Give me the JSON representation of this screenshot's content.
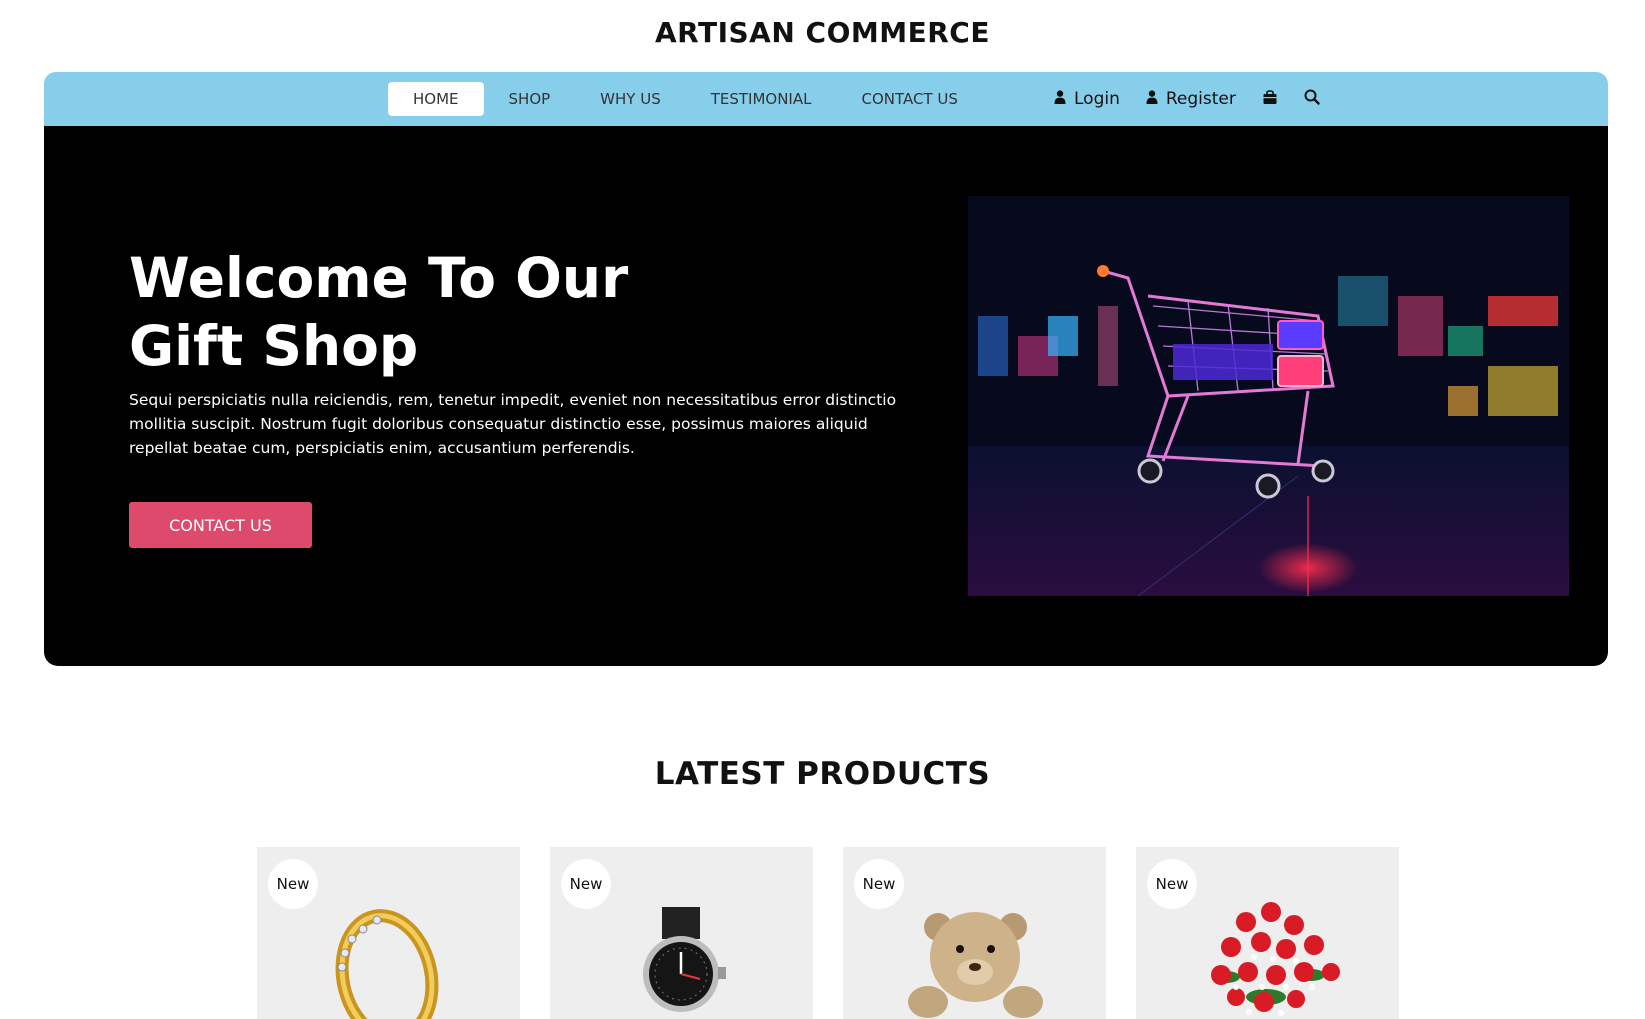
{
  "site": {
    "title": "ARTISAN COMMERCE"
  },
  "nav": {
    "links": [
      {
        "label": "HOME",
        "active": true
      },
      {
        "label": "SHOP",
        "active": false
      },
      {
        "label": "WHY US",
        "active": false
      },
      {
        "label": "TESTIMONIAL",
        "active": false
      },
      {
        "label": "CONTACT US",
        "active": false
      }
    ],
    "login_label": "Login",
    "register_label": "Register",
    "cart_icon": "shopping-bag-icon",
    "search_icon": "search-icon",
    "bar_color": "#87ceeb"
  },
  "hero": {
    "title_line1": "Welcome To Our",
    "title_line2": "Gift Shop",
    "text": "Sequi perspiciatis nulla reiciendis, rem, tenetur impedit, eveniet non necessitatibus error distinctio mollitia suscipit. Nostrum fugit doloribus consequatur distinctio esse, possimus maiores aliquid repellat beatae cum, perspiciatis enim, accusantium perferendis.",
    "button_label": "CONTACT US",
    "button_color": "#de4a6b",
    "image": "neon-shopping-cart"
  },
  "latest": {
    "title": "LATEST PRODUCTS",
    "products": [
      {
        "badge": "New",
        "image": "gold-ring"
      },
      {
        "badge": "New",
        "image": "wrist-watch"
      },
      {
        "badge": "New",
        "image": "teddy-bear"
      },
      {
        "badge": "New",
        "image": "red-roses-bouquet"
      }
    ]
  }
}
